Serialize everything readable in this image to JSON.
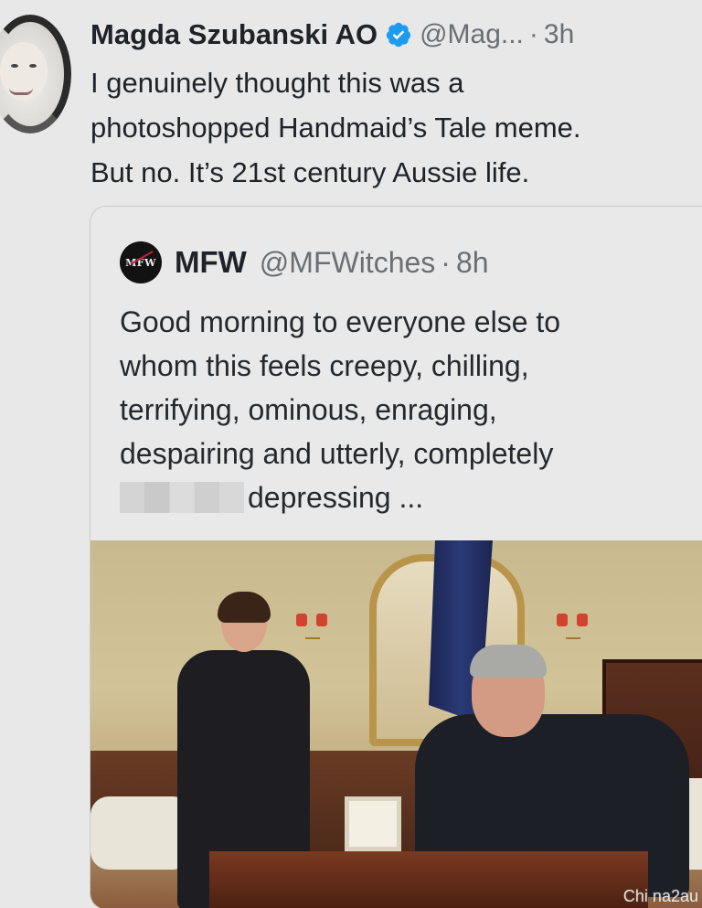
{
  "tweet": {
    "author": {
      "display_name": "Magda Szubanski AO",
      "handle": "@Mag...",
      "verified": true,
      "avatar_icon": "profile-photo"
    },
    "time": "3h",
    "dot": "·",
    "text_lines": [
      "I genuinely thought this was a",
      "photoshopped Handmaid’s Tale meme.",
      "But no. It’s 21st century Aussie life."
    ]
  },
  "quoted_tweet": {
    "author": {
      "display_name": "MFW",
      "handle": "@MFWitches",
      "avatar_text": "MFW"
    },
    "dot": "·",
    "time": "8h",
    "text_lines": [
      "Good morning to everyone else to",
      "whom this feels creepy, chilling,",
      "terrifying, ominous, enraging,",
      "despairing and utterly, completely"
    ],
    "last_line_after_redaction": "depressing ..."
  },
  "watermark": "Chi na2au",
  "colors": {
    "verified_blue": "#1d9bf0",
    "background": "#e7e8e7",
    "secondary_text": "#6a6f74"
  }
}
